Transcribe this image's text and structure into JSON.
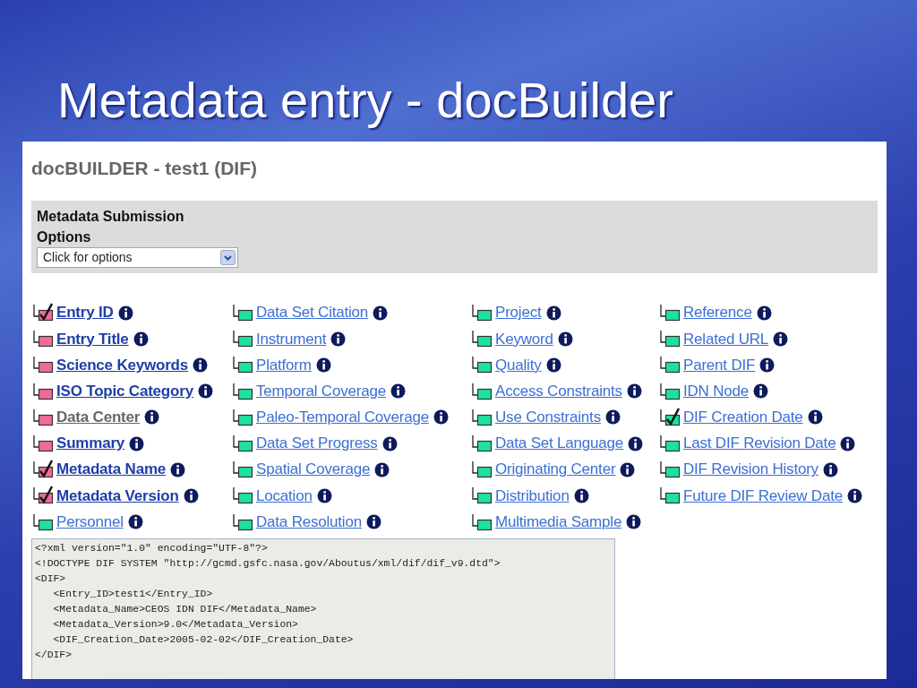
{
  "slide_title": "Metadata entry - docBuilder",
  "app": {
    "title": "docBUILDER - test1 (DIF)",
    "options_panel": {
      "label": "Metadata Submission Options",
      "dropdown": {
        "value": "Click for options"
      }
    },
    "field_columns": [
      [
        {
          "label": "Entry ID",
          "required": true,
          "checked": true,
          "disabled": false
        },
        {
          "label": "Entry Title",
          "required": true,
          "checked": false,
          "disabled": false
        },
        {
          "label": "Science Keywords",
          "required": true,
          "checked": false,
          "disabled": false
        },
        {
          "label": "ISO Topic Category",
          "required": true,
          "checked": false,
          "disabled": false
        },
        {
          "label": "Data Center",
          "required": true,
          "checked": false,
          "disabled": true
        },
        {
          "label": "Summary",
          "required": true,
          "checked": false,
          "disabled": false
        },
        {
          "label": "Metadata Name",
          "required": true,
          "checked": true,
          "disabled": false
        },
        {
          "label": "Metadata Version",
          "required": true,
          "checked": true,
          "disabled": false
        },
        {
          "label": "Personnel",
          "required": false,
          "checked": false,
          "disabled": false
        }
      ],
      [
        {
          "label": "Data Set Citation",
          "required": false,
          "checked": false,
          "disabled": false
        },
        {
          "label": "Instrument",
          "required": false,
          "checked": false,
          "disabled": false
        },
        {
          "label": "Platform",
          "required": false,
          "checked": false,
          "disabled": false
        },
        {
          "label": "Temporal Coverage",
          "required": false,
          "checked": false,
          "disabled": false
        },
        {
          "label": "Paleo-Temporal Coverage",
          "required": false,
          "checked": false,
          "disabled": false
        },
        {
          "label": "Data Set Progress",
          "required": false,
          "checked": false,
          "disabled": false
        },
        {
          "label": "Spatial Coverage",
          "required": false,
          "checked": false,
          "disabled": false
        },
        {
          "label": "Location",
          "required": false,
          "checked": false,
          "disabled": false
        },
        {
          "label": "Data Resolution",
          "required": false,
          "checked": false,
          "disabled": false
        }
      ],
      [
        {
          "label": "Project",
          "required": false,
          "checked": false,
          "disabled": false
        },
        {
          "label": "Keyword",
          "required": false,
          "checked": false,
          "disabled": false
        },
        {
          "label": "Quality",
          "required": false,
          "checked": false,
          "disabled": false
        },
        {
          "label": "Access Constraints",
          "required": false,
          "checked": false,
          "disabled": false
        },
        {
          "label": "Use Constraints",
          "required": false,
          "checked": false,
          "disabled": false
        },
        {
          "label": "Data Set Language",
          "required": false,
          "checked": false,
          "disabled": false
        },
        {
          "label": "Originating Center",
          "required": false,
          "checked": false,
          "disabled": false
        },
        {
          "label": "Distribution",
          "required": false,
          "checked": false,
          "disabled": false
        },
        {
          "label": "Multimedia Sample",
          "required": false,
          "checked": false,
          "disabled": false
        }
      ],
      [
        {
          "label": "Reference",
          "required": false,
          "checked": false,
          "disabled": false
        },
        {
          "label": "Related URL",
          "required": false,
          "checked": false,
          "disabled": false
        },
        {
          "label": "Parent DIF",
          "required": false,
          "checked": false,
          "disabled": false
        },
        {
          "label": "IDN Node",
          "required": false,
          "checked": false,
          "disabled": false
        },
        {
          "label": "DIF Creation Date",
          "required": false,
          "checked": true,
          "disabled": false
        },
        {
          "label": "Last DIF Revision Date",
          "required": false,
          "checked": false,
          "disabled": false
        },
        {
          "label": "DIF Revision History",
          "required": false,
          "checked": false,
          "disabled": false
        },
        {
          "label": "Future DIF Review Date",
          "required": false,
          "checked": false,
          "disabled": false
        }
      ]
    ],
    "xml_preview": [
      "<?xml version=\"1.0\" encoding=\"UTF-8\"?>",
      "<!DOCTYPE DIF SYSTEM \"http://gcmd.gsfc.nasa.gov/Aboutus/xml/dif/dif_v9.dtd\">",
      "<DIF>",
      "   <Entry_ID>test1</Entry_ID>",
      "   <Metadata_Name>CEOS IDN DIF</Metadata_Name>",
      "   <Metadata_Version>9.0</Metadata_Version>",
      "   <DIF_Creation_Date>2005-02-02</DIF_Creation_Date>",
      "</DIF>"
    ]
  }
}
